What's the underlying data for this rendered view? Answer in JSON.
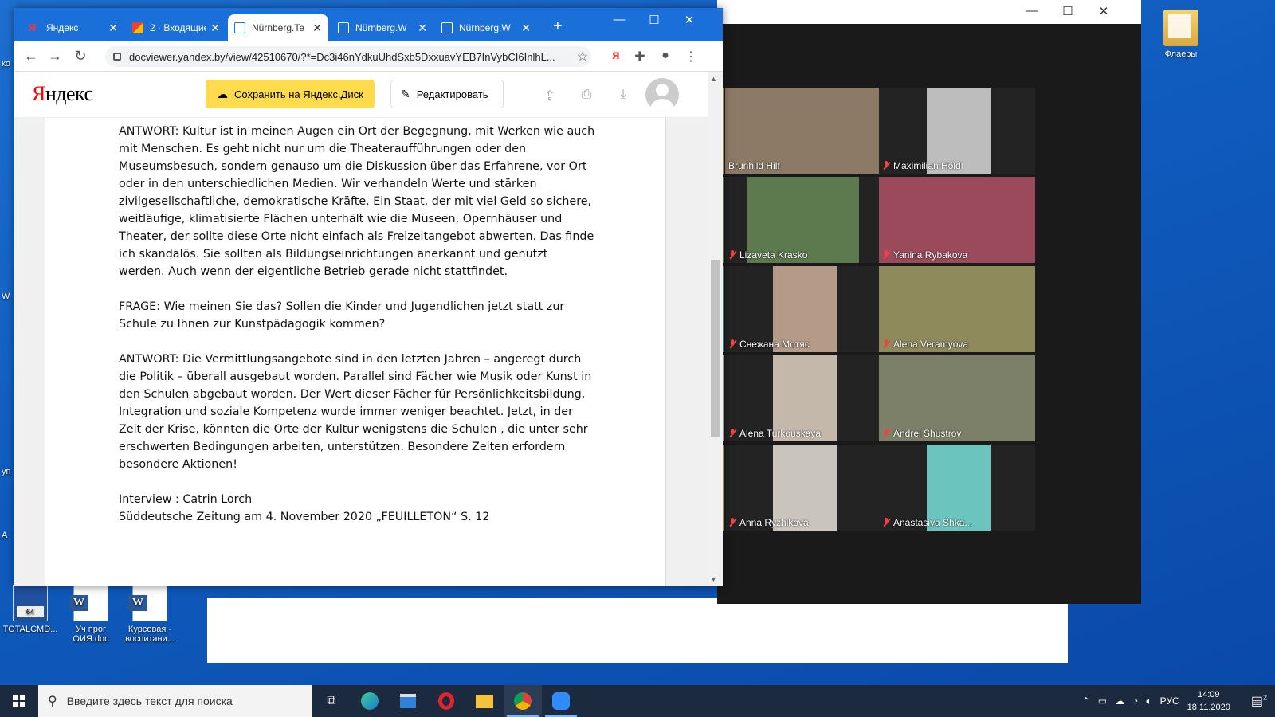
{
  "desktop": {
    "icons": [
      {
        "label": "Флаеры"
      },
      {
        "label": "TOTALCMD..."
      },
      {
        "label": "Уч прог ОИЯ.doc"
      },
      {
        "label": "Курсовая - воспитани..."
      }
    ],
    "left_edge": [
      "ко",
      "W",
      "уп",
      "А"
    ]
  },
  "browser": {
    "tabs": [
      {
        "label": "Яндекс",
        "icon": "yandex-icon"
      },
      {
        "label": "2 · Входящие",
        "icon": "gmail-icon"
      },
      {
        "label": "Nürnberg.Te",
        "icon": "doc-icon",
        "active": true
      },
      {
        "label": "Nürnberg.W",
        "icon": "doc-icon"
      },
      {
        "label": "Nürnberg.W",
        "icon": "doc-icon"
      }
    ],
    "url": "docviewer.yandex.by/view/42510670/?*=Dc3i46nYdkuUhdSxb5DxxuavYEB7InVybCI6InlhL...",
    "yandex": {
      "logo": "Яндекс",
      "save_label": "Сохранить на Яндекс.Диск",
      "edit_label": "Редактировать"
    },
    "document": {
      "paragraphs": [
        "ANTWORT: Kultur ist in meinen Augen ein Ort der Begegnung, mit Werken wie auch mit Menschen. Es geht nicht nur um die Theateraufführungen oder den Museumsbesuch, sondern genauso um die Diskussion über das Erfahrene, vor Ort oder in den unterschiedlichen Medien. Wir verhandeln Werte und stärken zivilgesellschaftliche, demokratische Kräfte. Ein Staat, der mit viel Geld so sichere, weitläufige, klimatisierte Flächen unterhält wie die Museen, Opernhäuser und Theater, der sollte diese Orte nicht einfach als Freizeitangebot abwerten. Das finde ich skandalös. Sie sollten als Bildungseinrichtungen anerkannt und genutzt werden. Auch wenn der eigentliche Betrieb gerade nicht stattfindet.",
        "FRAGE: Wie meinen Sie das? Sollen die Kinder und Jugendlichen jetzt statt zur Schule zu Ihnen zur Kunstpädagogik kommen?",
        "ANTWORT: Die Vermittlungsangebote sind in den letzten Jahren – angeregt durch die Politik – überall ausgebaut worden. Parallel sind Fächer wie Musik oder Kunst in den Schulen abgebaut worden. Der Wert dieser Fächer für Persönlichkeitsbildung, Integration und soziale Kompetenz wurde immer weniger beachtet. Jetzt, in der Zeit der Krise, könnten die Orte der Kultur wenigstens die Schulen , die unter sehr erschwerten Bedingungen arbeiten, unterstützen. Besondere Zeiten erfordern besondere Aktionen!",
        "Interview : Catrin Lorch\nSüddeutsche Zeitung am 4. November 2020 „FEUILLETON“ S. 12"
      ]
    }
  },
  "zoom": {
    "participants": [
      {
        "name": "Brunhild Hilf",
        "muted": false,
        "active": true,
        "color": "#8c7a66"
      },
      {
        "name": "Maximilian Höldl",
        "muted": true,
        "color": "#bdbdbd"
      },
      {
        "name": "Lizaveta Krasko",
        "muted": true,
        "color": "#5c7a4e"
      },
      {
        "name": "Yanina Rybakova",
        "muted": true,
        "color": "#9a4a5a"
      },
      {
        "name": "Снежана Мотяс",
        "muted": true,
        "color": "#b59a88"
      },
      {
        "name": "Alena Veramyova",
        "muted": true,
        "color": "#8e8a5c"
      },
      {
        "name": "Alena Turkouskaya",
        "muted": true,
        "color": "#c4b8ab"
      },
      {
        "name": "Andrei Shustrov",
        "muted": true,
        "color": "#7d8068"
      },
      {
        "name": "Anna Ryzhikova",
        "muted": true,
        "color": "#c9c4bc"
      },
      {
        "name": "Anastasiya Shka...",
        "muted": true,
        "color": "#6bc4bd"
      }
    ]
  },
  "taskbar": {
    "search_placeholder": "Введите здесь текст для поиска",
    "lang": "РУС",
    "time": "14:09",
    "date": "18.11.2020",
    "notifications": "2"
  }
}
